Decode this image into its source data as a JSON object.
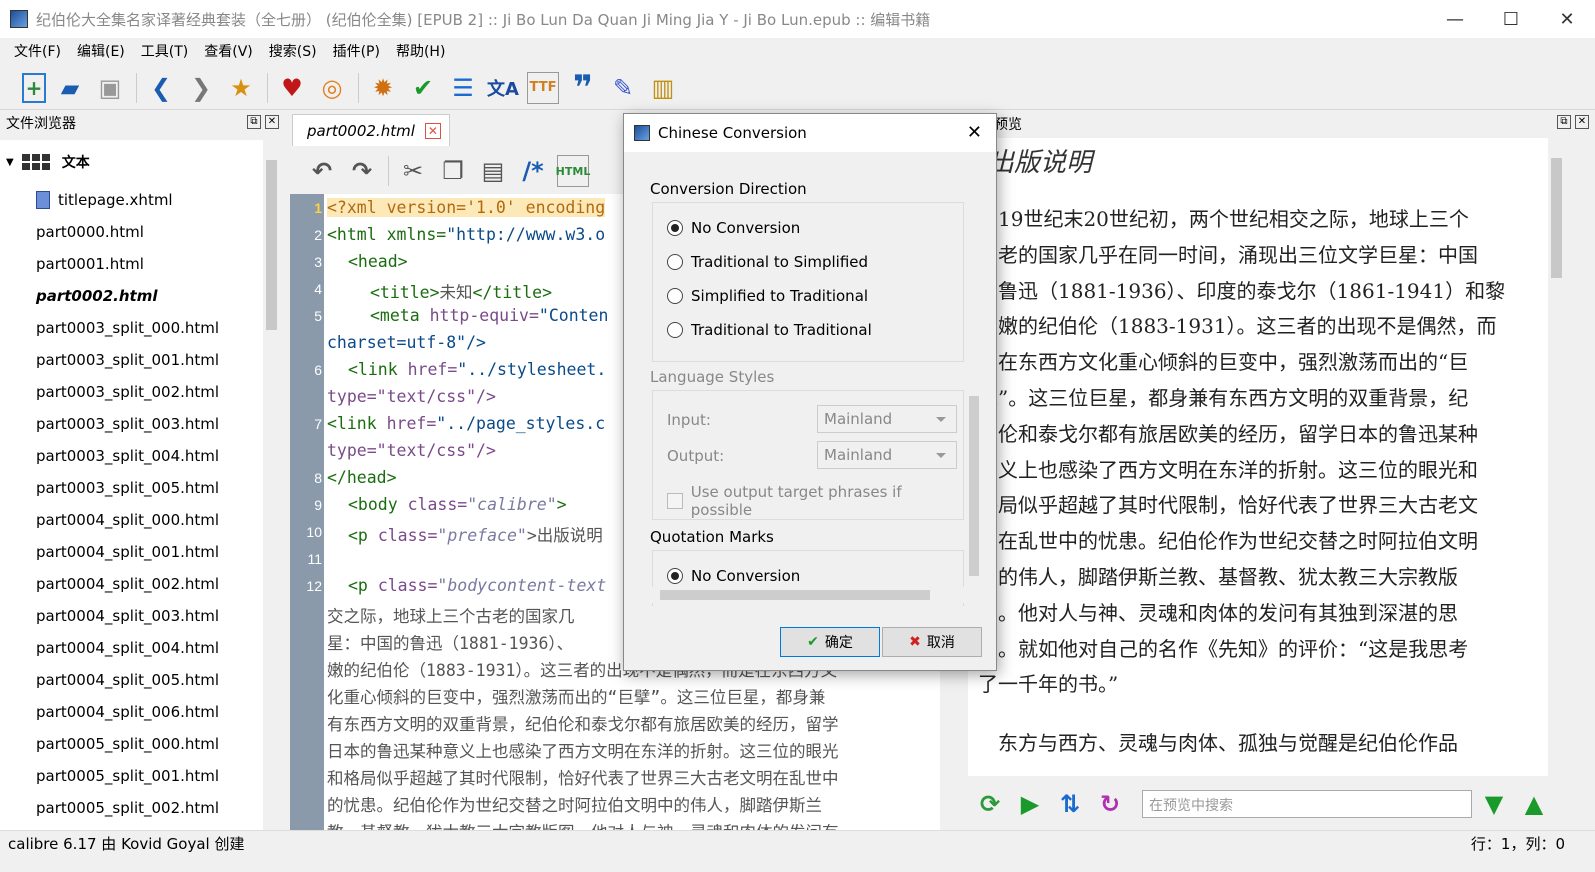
{
  "window": {
    "title": "纪伯伦大全集名家译著经典套装（全七册） (纪伯伦全集) [EPUB 2] :: Ji Bo Lun Da Quan Ji Ming Jia Y - Ji Bo Lun.epub :: 编辑书籍",
    "minimize": "—",
    "maximize": "☐",
    "close": "✕"
  },
  "menu": [
    "文件(F)",
    "编辑(E)",
    "工具(T)",
    "查看(V)",
    "搜索(S)",
    "插件(P)",
    "帮助(H)"
  ],
  "toolbar_icons": [
    "new-file-icon",
    "open-folder-icon",
    "save-icon",
    "back-arrow-icon",
    "forward-arrow-icon",
    "checkpoint-icon",
    "heart-icon",
    "lifebuoy-icon",
    "bug-icon",
    "spellcheck-icon",
    "reports-icon",
    "translate-icon",
    "font-icon",
    "quote-icon",
    "edit-eraser-icon",
    "stats-icon"
  ],
  "filebrowser": {
    "title": "文件浏览器",
    "root_label": "文本",
    "files": [
      "titlepage.xhtml",
      "part0000.html",
      "part0001.html",
      "part0002.html",
      "part0003_split_000.html",
      "part0003_split_001.html",
      "part0003_split_002.html",
      "part0003_split_003.html",
      "part0003_split_004.html",
      "part0003_split_005.html",
      "part0004_split_000.html",
      "part0004_split_001.html",
      "part0004_split_002.html",
      "part0004_split_003.html",
      "part0004_split_004.html",
      "part0004_split_005.html",
      "part0004_split_006.html",
      "part0005_split_000.html",
      "part0005_split_001.html",
      "part0005_split_002.html"
    ],
    "active_file": "part0002.html"
  },
  "editor": {
    "tab": "part0002.html",
    "lines": {
      "l1": "<?xml version='1.0' encoding",
      "l2a": "<html xmlns=",
      "l2b": "\"http://www.w3.o",
      "l3": "<head>",
      "l4a": "<title>",
      "l4b": "未知",
      "l4c": "</title>",
      "l5a": "<meta ",
      "l5b": "http-equiv=",
      "l5c": "\"Conten",
      "l5d": "charset=utf-8\"/>",
      "l6a": "<link ",
      "l6b": "href=",
      "l6c": "\"../stylesheet.",
      "l6d": "type=\"text/css\"/>",
      "l7a": "<link ",
      "l7b": "href=",
      "l7c": "\"../page_styles.c",
      "l7d": "type=\"text/css\"/>",
      "l8": "</head>",
      "l9a": "<body ",
      "l9b": "class=",
      "l9c": "\"calibre\"",
      "l9d": ">",
      "l10a": "<p ",
      "l10b": "class=",
      "l10c": "\"preface\"",
      "l10d": ">出版说明",
      "l12a": "<p ",
      "l12b": "class=",
      "l12c": "\"bodycontent-text",
      "w1": "交之际，地球上三个古老的国家几",
      "w2": "星：中国的鲁迅（1881-1936）、",
      "w3": "嫩的纪伯伦（1883-1931）。这三者的出现不是偶然，而是在东西方文",
      "w4": "化重心倾斜的巨变中，强烈激荡而出的“巨擘”。这三位巨星，都身兼",
      "w5": "有东西方文明的双重背景，纪伯伦和泰戈尔都有旅居欧美的经历，留学",
      "w6": "日本的鲁迅某种意义上也感染了西方文明在东洋的折射。这三位的眼光",
      "w7": "和格局似乎超越了其时代限制，恰好代表了世界三大古老文明在乱世中",
      "w8": "的忧患。纪伯伦作为世纪交替之时阿拉伯文明中的伟人，脚踏伊斯兰",
      "w9": "教、基督教、犹太教三大宗教版图，他对人与神、灵魂和肉体的发问有"
    },
    "line_numbers": [
      "1",
      "2",
      "3",
      "4",
      "5",
      "6",
      "7",
      "8",
      "9",
      "10",
      "11",
      "12"
    ]
  },
  "preview": {
    "title": "预览",
    "heading": "出版说明",
    "p1": [
      "　19世纪末20世纪初，两个世纪相交之际，地球上三个",
      "古老的国家几乎在同一时间，涌现出三位文学巨星：中国",
      "的鲁迅（1881-1936）、印度的泰戈尔（1861-1941）和黎",
      "巴嫩的纪伯伦（1883-1931）。这三者的出现不是偶然，而",
      "是在东西方文化重心倾斜的巨变中，强烈激荡而出的“巨",
      "擘”。这三位巨星，都身兼有东西方文明的双重背景，纪",
      "伯伦和泰戈尔都有旅居欧美的经历，留学日本的鲁迅某种",
      "意义上也感染了西方文明在东洋的折射。这三位的眼光和",
      "格局似乎超越了其时代限制，恰好代表了世界三大古老文",
      "明在乱世中的忧患。纪伯伦作为世纪交替之时阿拉伯文明",
      "中的伟人，脚踏伊斯兰教、基督教、犹太教三大宗教版",
      "图。他对人与神、灵魂和肉体的发问有其独到深湛的思",
      "考。就如他对自己的名作《先知》的评价：“这是我思考",
      "了一千年的书。”"
    ],
    "p2": "　东方与西方、灵魂与肉体、孤独与觉醒是纪伯伦作品",
    "search_placeholder": "在预览中搜索"
  },
  "status": {
    "left": "calibre 6.17 由 Kovid Goyal 创建",
    "position": "行：1，列：0"
  },
  "dialog": {
    "title": "Chinese Conversion",
    "section_direction": "Conversion Direction",
    "direction_options": [
      "No Conversion",
      "Traditional to Simplified",
      "Simplified to Traditional",
      "Traditional to Traditional"
    ],
    "direction_selected": "No Conversion",
    "section_language": "Language Styles",
    "input_label": "Input:",
    "input_value": "Mainland",
    "output_label": "Output:",
    "output_value": "Mainland",
    "phrases_label": "Use output target phrases if possible",
    "section_quotes": "Quotation Marks",
    "quote_option": "No Conversion",
    "ok_label": "确定",
    "cancel_label": "取消"
  }
}
